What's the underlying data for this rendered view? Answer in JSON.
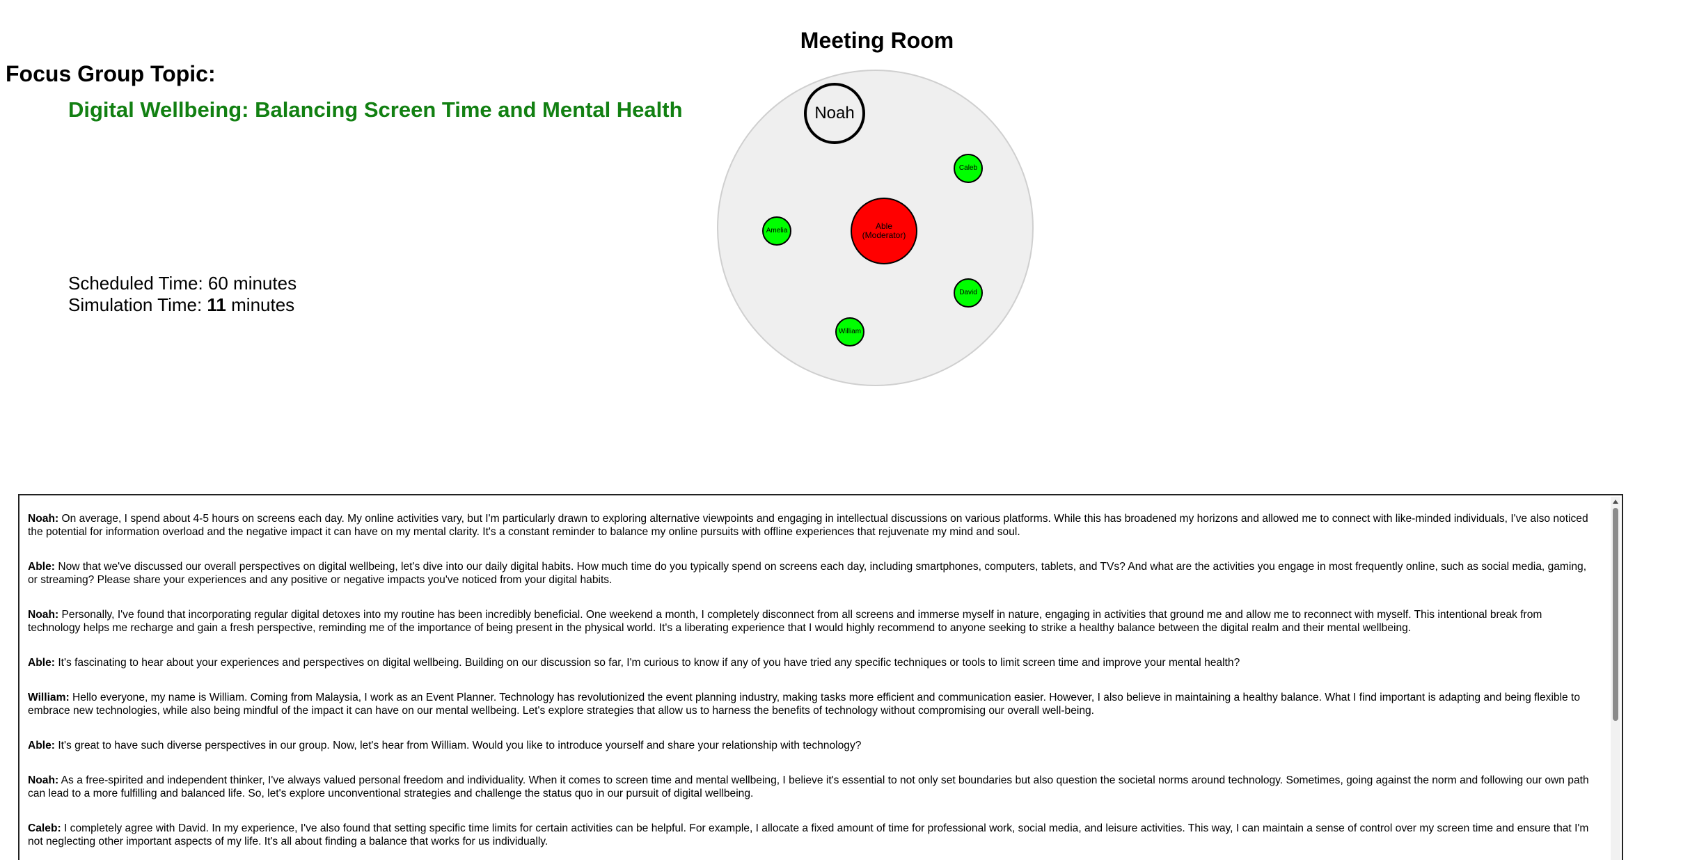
{
  "topic": {
    "label": "Focus Group Topic:",
    "title": "Digital Wellbeing: Balancing Screen Time and Mental Health"
  },
  "time": {
    "scheduled_label": "Scheduled Time: ",
    "scheduled_value": "60",
    "scheduled_unit": " minutes",
    "simulation_label": "Simulation Time: ",
    "simulation_value": "11",
    "simulation_unit": " minutes"
  },
  "room": {
    "title": "Meeting Room",
    "speaking": "Noah",
    "moderator_name": "Able",
    "moderator_role": "(Moderator)",
    "participants": [
      "Caleb",
      "Amelia",
      "David",
      "William"
    ]
  },
  "colors": {
    "topic_title": "#128012",
    "participant": "#00ff00",
    "moderator": "#ff0000",
    "room_bg": "#efefef"
  },
  "transcript": [
    {
      "speaker": "Noah:",
      "text": " On average, I spend about 4-5 hours on screens each day. My online activities vary, but I'm particularly drawn to exploring alternative viewpoints and engaging in intellectual discussions on various platforms. While this has broadened my horizons and allowed me to connect with like-minded individuals, I've also noticed the potential for information overload and the negative impact it can have on my mental clarity. It's a constant reminder to balance my online pursuits with offline experiences that rejuvenate my mind and soul."
    },
    {
      "speaker": "Able:",
      "text": " Now that we've discussed our overall perspectives on digital wellbeing, let's dive into our daily digital habits. How much time do you typically spend on screens each day, including smartphones, computers, tablets, and TVs? And what are the activities you engage in most frequently online, such as social media, gaming, or streaming? Please share your experiences and any positive or negative impacts you've noticed from your digital habits."
    },
    {
      "speaker": "Noah:",
      "text": " Personally, I've found that incorporating regular digital detoxes into my routine has been incredibly beneficial. One weekend a month, I completely disconnect from all screens and immerse myself in nature, engaging in activities that ground me and allow me to reconnect with myself. This intentional break from technology helps me recharge and gain a fresh perspective, reminding me of the importance of being present in the physical world. It's a liberating experience that I would highly recommend to anyone seeking to strike a healthy balance between the digital realm and their mental wellbeing."
    },
    {
      "speaker": "Able:",
      "text": " It's fascinating to hear about your experiences and perspectives on digital wellbeing. Building on our discussion so far, I'm curious to know if any of you have tried any specific techniques or tools to limit screen time and improve your mental health?"
    },
    {
      "speaker": "William:",
      "text": " Hello everyone, my name is William. Coming from Malaysia, I work as an Event Planner. Technology has revolutionized the event planning industry, making tasks more efficient and communication easier. However, I also believe in maintaining a healthy balance. What I find important is adapting and being flexible to embrace new technologies, while also being mindful of the impact it can have on our mental wellbeing. Let's explore strategies that allow us to harness the benefits of technology without compromising our overall well-being."
    },
    {
      "speaker": "Able:",
      "text": " It's great to have such diverse perspectives in our group. Now, let's hear from William. Would you like to introduce yourself and share your relationship with technology?"
    },
    {
      "speaker": "Noah:",
      "text": " As a free-spirited and independent thinker, I've always valued personal freedom and individuality. When it comes to screen time and mental wellbeing, I believe it's essential to not only set boundaries but also question the societal norms around technology. Sometimes, going against the norm and following our own path can lead to a more fulfilling and balanced life. So, let's explore unconventional strategies and challenge the status quo in our pursuit of digital wellbeing."
    },
    {
      "speaker": "Caleb:",
      "text": " I completely agree with David. In my experience, I've also found that setting specific time limits for certain activities can be helpful. For example, I allocate a fixed amount of time for professional work, social media, and leisure activities. This way, I can maintain a sense of control over my screen time and ensure that I'm not neglecting other important aspects of my life. It's all about finding a balance that works for us individually."
    }
  ]
}
